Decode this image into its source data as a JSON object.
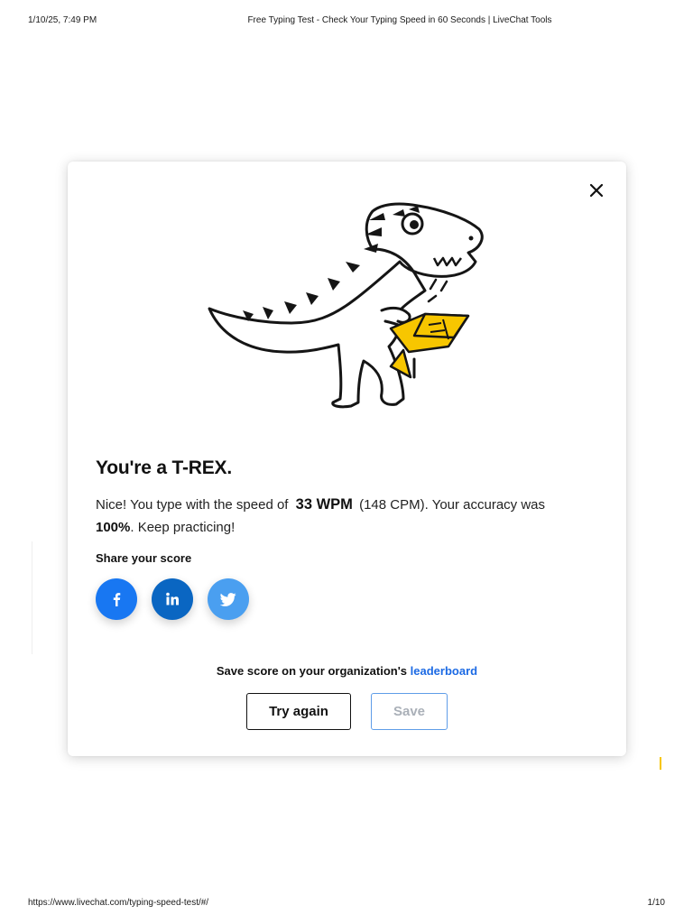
{
  "print_header": {
    "datetime": "1/10/25, 7:49 PM",
    "page_title": "Free Typing Test - Check Your Typing Speed in 60 Seconds | LiveChat Tools"
  },
  "print_footer": {
    "url": "https://www.livechat.com/typing-speed-test/#/",
    "page_number": "1/10"
  },
  "modal": {
    "close_icon": "close-icon",
    "illustration": "t-rex-typing-on-laptop",
    "title": "You're a T-REX.",
    "result": {
      "prefix": "Nice! You type with the speed of",
      "wpm": "33 WPM",
      "cpm": "(148 CPM).",
      "accuracy_prefix": "Your accuracy was",
      "accuracy": "100%",
      "suffix": ". Keep practicing!"
    },
    "share": {
      "label": "Share your score",
      "buttons": [
        {
          "network": "Facebook",
          "icon": "facebook-icon",
          "glyph": "f",
          "color": "#1877f2"
        },
        {
          "network": "LinkedIn",
          "icon": "linkedin-icon",
          "glyph": "in",
          "color": "#0a66c2"
        },
        {
          "network": "Twitter",
          "icon": "twitter-icon",
          "glyph": "bird",
          "color": "#4a9ff0"
        }
      ]
    },
    "leaderboard": {
      "text": "Save score on your organization's",
      "link": "leaderboard"
    },
    "buttons": {
      "try_again": "Try again",
      "save": "Save"
    }
  },
  "colors": {
    "accent_blue": "#1c6ae4",
    "dino_yellow": "#f7c600",
    "save_border": "#5f9de8"
  }
}
